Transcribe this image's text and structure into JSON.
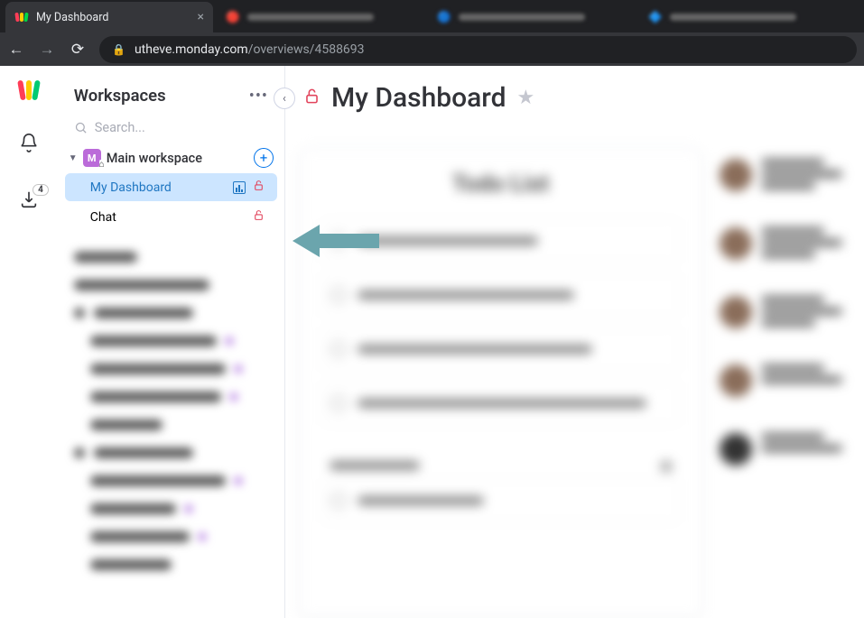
{
  "browser": {
    "active_tab_title": "My Dashboard",
    "url_domain": "utheve.monday.com",
    "url_path": "/overviews/4588693"
  },
  "left_rail": {
    "notif_badge": "4"
  },
  "sidebar": {
    "title": "Workspaces",
    "search_placeholder": "Search...",
    "workspace_letter": "M",
    "workspace_name": "Main workspace",
    "items": [
      {
        "label": "My Dashboard"
      },
      {
        "label": "Chat"
      }
    ]
  },
  "header": {
    "title": "My Dashboard"
  },
  "todo": {
    "title": "Todo List"
  }
}
